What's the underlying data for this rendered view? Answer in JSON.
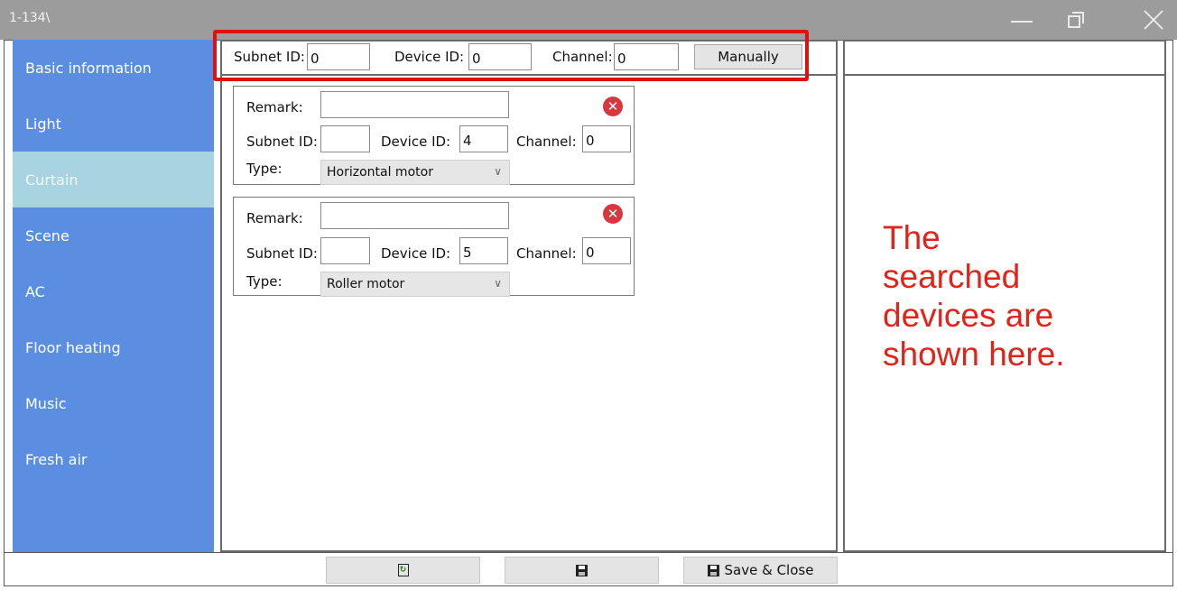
{
  "window": {
    "title": "1-134\\"
  },
  "sidebar": {
    "items": [
      {
        "label": "Basic information"
      },
      {
        "label": "Light"
      },
      {
        "label": "Curtain"
      },
      {
        "label": "Scene"
      },
      {
        "label": "AC"
      },
      {
        "label": "Floor heating"
      },
      {
        "label": "Music"
      },
      {
        "label": "Fresh air"
      }
    ],
    "active_item": "Curtain"
  },
  "manual_bar": {
    "subnet_label": "Subnet ID:",
    "subnet_value": "0",
    "device_label": "Device ID:",
    "device_value": "0",
    "channel_label": "Channel:",
    "channel_value": "0",
    "button_label": "Manually"
  },
  "devices": [
    {
      "remark_label": "Remark:",
      "remark_value": "",
      "subnet_label": "Subnet ID:",
      "subnet_value": "",
      "device_label": "Device ID:",
      "device_value": "4",
      "channel_label": "Channel:",
      "channel_value": "0",
      "type_label": "Type:",
      "type_value": "Horizontal motor"
    },
    {
      "remark_label": "Remark:",
      "remark_value": "",
      "subnet_label": "Subnet ID:",
      "subnet_value": "",
      "device_label": "Device ID:",
      "device_value": "5",
      "channel_label": "Channel:",
      "channel_value": "0",
      "type_label": "Type:",
      "type_value": "Roller motor"
    }
  ],
  "annotation": {
    "lines": [
      "The",
      "searched",
      "devices are",
      "shown here."
    ],
    "color": "#e2231a"
  },
  "footer": {
    "save_close_label": "Save & Close"
  },
  "colors": {
    "sidebar_bg": "#5b8ee0",
    "sidebar_active_bg": "#a8d3e0",
    "titlebar_bg": "#9c9c9c",
    "highlight": "#e01010",
    "remove_icon": "#d9363e"
  }
}
